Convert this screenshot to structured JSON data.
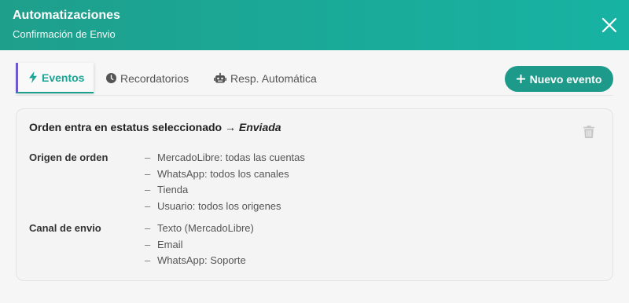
{
  "header": {
    "title": "Automatizaciones",
    "subtitle": "Confirmación de Envio"
  },
  "tabs": [
    {
      "label": "Eventos",
      "icon": "bolt-icon",
      "active": true
    },
    {
      "label": "Recordatorios",
      "icon": "clock-icon",
      "active": false
    },
    {
      "label": "Resp. Automática",
      "icon": "robot-icon",
      "active": false
    }
  ],
  "actions": {
    "new_event_label": "Nuevo evento"
  },
  "event": {
    "trigger_text": "Orden entra en estatus seleccionado",
    "arrow": "→",
    "status": "Enviada",
    "sections": [
      {
        "label": "Origen de orden",
        "items": [
          "MercadoLibre: todas las cuentas",
          "WhatsApp: todos los canales",
          "Tienda",
          "Usuario: todos los origenes"
        ]
      },
      {
        "label": "Canal de envio",
        "items": [
          "Texto (MercadoLibre)",
          "Email",
          "WhatsApp: Soporte"
        ]
      }
    ],
    "bullet": "–"
  },
  "colors": {
    "header_start": "#1e9f8c",
    "header_end": "#17b3a3",
    "accent": "#1e9a8a",
    "tab_active_text": "#18a596",
    "tab_left_border": "#6a5acd"
  }
}
